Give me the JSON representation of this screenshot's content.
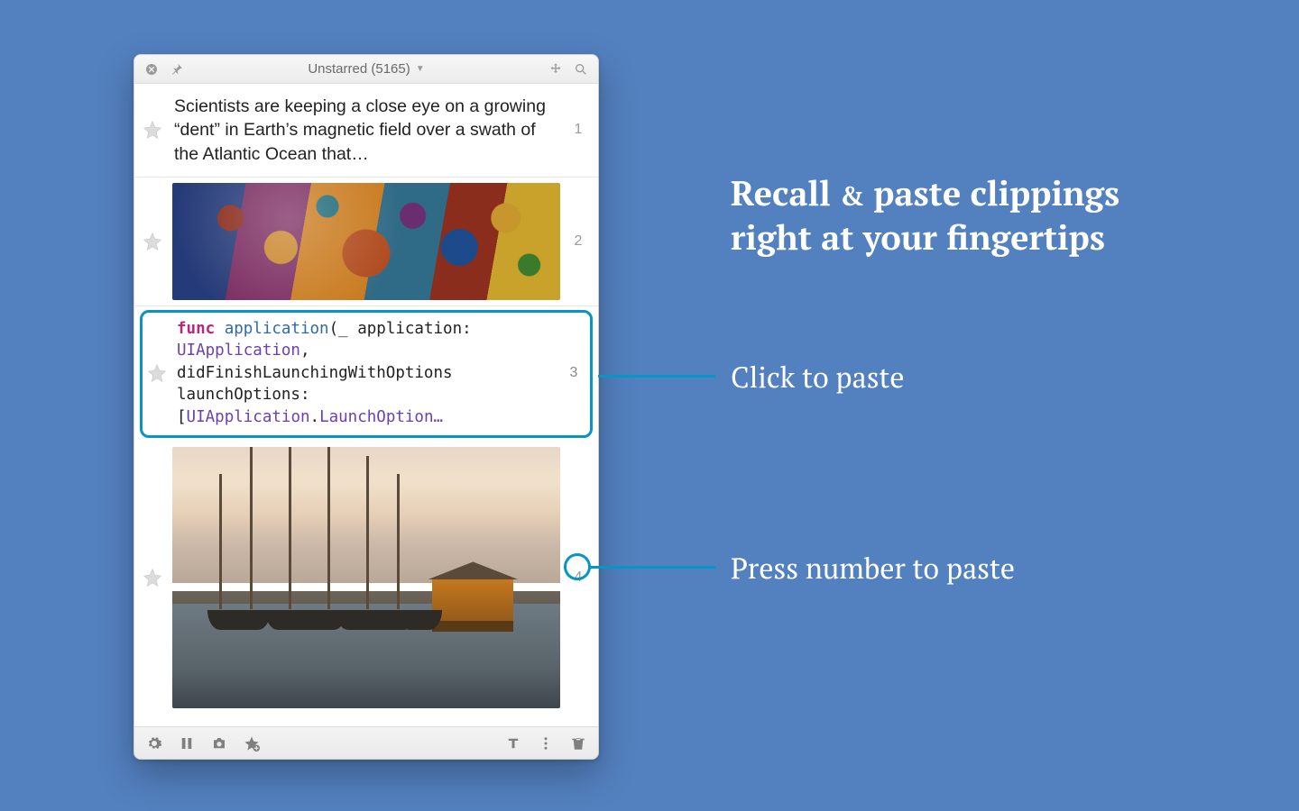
{
  "marketing": {
    "headline_pre": "Recall",
    "headline_amp": "&",
    "headline_post": "paste clippings",
    "headline_line2": "right at your fingertips",
    "caption_click": "Click to paste",
    "caption_number": "Press number to paste"
  },
  "header": {
    "title": "Unstarred (5165)"
  },
  "rows": {
    "r1": {
      "num": "1",
      "text": "Scientists are keeping a close eye on a growing “dent” in Earth’s magnetic field over a swath of the Atlantic Ocean that…"
    },
    "r2": {
      "num": "2"
    },
    "r3": {
      "num": "3",
      "code": {
        "func": "func",
        "name": "application",
        "sig1": "(_ application:",
        "type1": "UIApplication",
        "comma": ",",
        "line2": "didFinishLaunchingWithOptions",
        "line3a": "launchOptions: [",
        "type2": "UIApplication",
        "dot": ".",
        "type3": "LaunchOption…"
      }
    },
    "r4": {
      "num": "4"
    }
  }
}
